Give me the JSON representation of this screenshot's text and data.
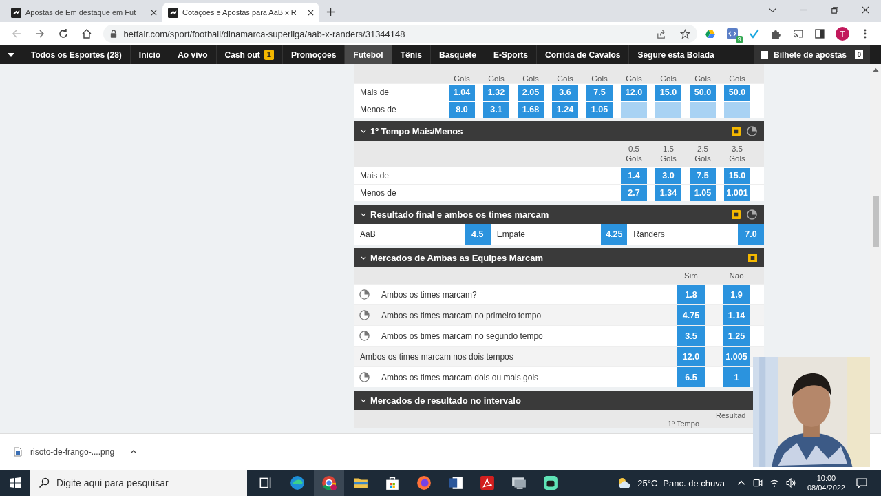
{
  "browser": {
    "tabs": [
      {
        "title": "Apostas de Em destaque em Fut",
        "selected": false
      },
      {
        "title": "Cotações e Apostas para AaB x R",
        "selected": true
      }
    ],
    "url": "betfair.com/sport/football/dinamarca-superliga/aab-x-randers/31344148",
    "extension_badge": "9",
    "profile_initial": "T"
  },
  "nav": {
    "items": [
      {
        "label": "Todos os Esportes (28)",
        "selected": false
      },
      {
        "label": "Início",
        "selected": false
      },
      {
        "label": "Ao vivo",
        "selected": false
      },
      {
        "label": "Cash out",
        "selected": false,
        "badge": "1"
      },
      {
        "label": "Promoções",
        "selected": false
      },
      {
        "label": "Futebol",
        "selected": true
      },
      {
        "label": "Tênis",
        "selected": false
      },
      {
        "label": "Basquete",
        "selected": false
      },
      {
        "label": "E-Sports",
        "selected": false
      },
      {
        "label": "Corrida de Cavalos",
        "selected": false
      },
      {
        "label": "Segure esta Bolada",
        "selected": false
      }
    ],
    "betslip": {
      "label": "Bilhete de apostas",
      "count": "0"
    }
  },
  "markets": [
    {
      "kind": "over_under",
      "columns": [
        {
          "unit": "Gols"
        },
        {
          "unit": "Gols"
        },
        {
          "unit": "Gols"
        },
        {
          "unit": "Gols"
        },
        {
          "unit": "Gols"
        },
        {
          "unit": "Gols"
        },
        {
          "unit": "Gols"
        },
        {
          "unit": "Gols"
        },
        {
          "unit": "Gols"
        }
      ],
      "rows": [
        {
          "label": "Mais de",
          "cells": [
            {
              "odds": "1.04",
              "available": true
            },
            {
              "odds": "1.32",
              "available": true
            },
            {
              "odds": "2.05",
              "available": true
            },
            {
              "odds": "3.6",
              "available": true
            },
            {
              "odds": "7.5",
              "available": true
            },
            {
              "odds": "12.0",
              "available": true
            },
            {
              "odds": "15.0",
              "available": true
            },
            {
              "odds": "50.0",
              "available": true
            },
            {
              "odds": "50.0",
              "available": true
            }
          ]
        },
        {
          "label": "Menos de",
          "cells": [
            {
              "odds": "8.0",
              "available": true
            },
            {
              "odds": "3.1",
              "available": true
            },
            {
              "odds": "1.68",
              "available": true
            },
            {
              "odds": "1.24",
              "available": true
            },
            {
              "odds": "1.05",
              "available": true
            },
            {
              "available": false
            },
            {
              "available": false
            },
            {
              "available": false
            },
            {
              "available": false
            }
          ]
        }
      ]
    },
    {
      "kind": "over_under",
      "title": "1º Tempo Mais/Menos",
      "cash_out": true,
      "in_play": true,
      "columns": [
        {
          "line": "0.5",
          "unit": "Gols"
        },
        {
          "line": "1.5",
          "unit": "Gols"
        },
        {
          "line": "2.5",
          "unit": "Gols"
        },
        {
          "line": "3.5",
          "unit": "Gols"
        }
      ],
      "rows": [
        {
          "label": "Mais de",
          "cells": [
            {
              "odds": "1.4",
              "available": true
            },
            {
              "odds": "3.0",
              "available": true
            },
            {
              "odds": "7.5",
              "available": true
            },
            {
              "odds": "15.0",
              "available": true
            }
          ]
        },
        {
          "label": "Menos de",
          "cells": [
            {
              "odds": "2.7",
              "available": true
            },
            {
              "odds": "1.34",
              "available": true
            },
            {
              "odds": "1.05",
              "available": true
            },
            {
              "odds": "1.001",
              "available": true
            }
          ]
        }
      ]
    },
    {
      "kind": "result",
      "title": "Resultado final e ambos os times marcam",
      "cash_out": true,
      "in_play": true,
      "selections": [
        {
          "name": "AaB",
          "odds": "4.5"
        },
        {
          "name": "Empate",
          "odds": "4.25"
        },
        {
          "name": "Randers",
          "odds": "7.0"
        }
      ]
    },
    {
      "kind": "yes_no",
      "title": "Mercados de Ambas as Equipes Marcam",
      "cash_out": true,
      "in_play": false,
      "columns": [
        "Sim",
        "Não"
      ],
      "rows": [
        {
          "label": "Ambos os times marcam?",
          "in_play": true,
          "odds": [
            "1.8",
            "1.9"
          ]
        },
        {
          "label": "Ambos os times marcam no primeiro tempo",
          "in_play": true,
          "odds": [
            "4.75",
            "1.14"
          ]
        },
        {
          "label": "Ambos os times marcam no segundo tempo",
          "in_play": true,
          "odds": [
            "3.5",
            "1.25"
          ]
        },
        {
          "label": "Ambos os times marcam nos dois tempos",
          "in_play": false,
          "odds": [
            "12.0",
            "1.005"
          ]
        },
        {
          "label": "Ambos os times marcam dois ou mais gols",
          "in_play": true,
          "odds": [
            "6.5",
            "1"
          ]
        }
      ]
    },
    {
      "kind": "header_only",
      "title": "Mercados de resultado no intervalo",
      "columns": [
        "1º Tempo",
        "Resultad"
      ]
    }
  ],
  "downloads": [
    {
      "file": "risoto-de-frango-....png"
    }
  ],
  "taskbar": {
    "search_placeholder": "Digite aqui para pesquisar",
    "temperature": "25°C",
    "weather": "Panc. de chuva",
    "time": "10:00",
    "date": "08/04/2022"
  }
}
